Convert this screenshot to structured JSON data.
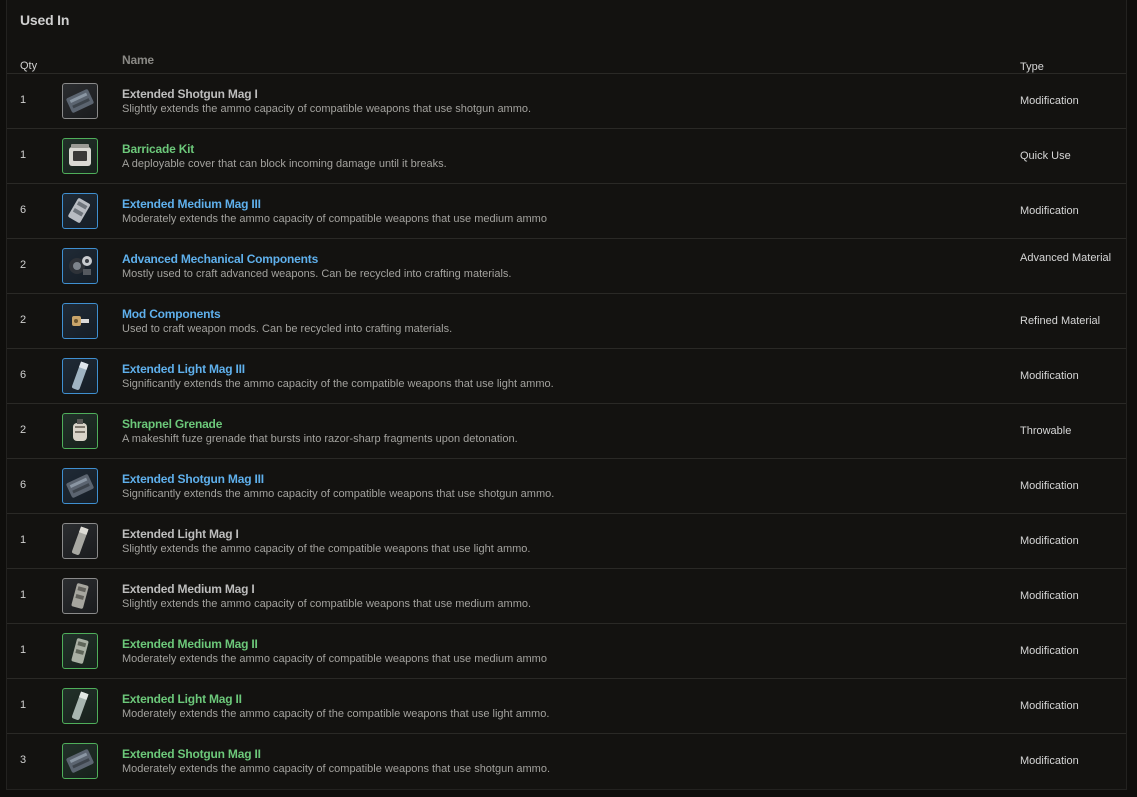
{
  "section_title": "Used In",
  "columns": {
    "qty": "Qty",
    "name": "Name",
    "type": "Type"
  },
  "rows": [
    {
      "qty": "1",
      "name": "Extended Shotgun Mag I",
      "rarity": "grey",
      "icon": "shotgun-mag-icon",
      "description": "Slightly extends the ammo capacity of compatible weapons that use shotgun ammo.",
      "type": "Modification"
    },
    {
      "qty": "1",
      "name": "Barricade Kit",
      "rarity": "green",
      "icon": "barricade-kit-icon",
      "description": "A deployable cover that can block incoming damage until it breaks.",
      "type": "Quick Use"
    },
    {
      "qty": "6",
      "name": "Extended Medium Mag III",
      "rarity": "blue",
      "icon": "medium-mag-icon",
      "description": "Moderately extends the ammo capacity of compatible weapons that use medium ammo",
      "type": "Modification"
    },
    {
      "qty": "2",
      "name": "Advanced Mechanical Components",
      "rarity": "blue",
      "icon": "mechanical-components-icon",
      "description": "Mostly used to craft advanced weapons. Can be recycled into crafting materials.",
      "type": "Advanced Material"
    },
    {
      "qty": "2",
      "name": "Mod Components",
      "rarity": "blue",
      "icon": "mod-components-icon",
      "description": "Used to craft weapon mods. Can be recycled into crafting materials.",
      "type": "Refined Material"
    },
    {
      "qty": "6",
      "name": "Extended Light Mag III",
      "rarity": "blue",
      "icon": "light-mag-icon",
      "description": "Significantly extends the ammo capacity of the compatible weapons that use light ammo.",
      "type": "Modification"
    },
    {
      "qty": "2",
      "name": "Shrapnel Grenade",
      "rarity": "green",
      "icon": "grenade-icon",
      "description": "A makeshift fuze grenade that bursts into razor-sharp fragments upon detonation.",
      "type": "Throwable"
    },
    {
      "qty": "6",
      "name": "Extended Shotgun Mag III",
      "rarity": "blue",
      "icon": "shotgun-mag-icon",
      "description": "Significantly extends the ammo capacity of compatible weapons that use shotgun ammo.",
      "type": "Modification"
    },
    {
      "qty": "1",
      "name": "Extended Light Mag I",
      "rarity": "grey",
      "icon": "light-mag-icon",
      "description": "Slightly extends the ammo capacity of the compatible weapons that use light ammo.",
      "type": "Modification"
    },
    {
      "qty": "1",
      "name": "Extended Medium Mag I",
      "rarity": "grey",
      "icon": "medium-mag-icon",
      "description": "Slightly extends the ammo capacity of compatible weapons that use medium ammo.",
      "type": "Modification"
    },
    {
      "qty": "1",
      "name": "Extended Medium Mag II",
      "rarity": "green",
      "icon": "medium-mag-icon",
      "description": "Moderately extends the ammo capacity of compatible weapons that use medium ammo",
      "type": "Modification"
    },
    {
      "qty": "1",
      "name": "Extended Light Mag II",
      "rarity": "green",
      "icon": "light-mag-icon",
      "description": "Moderately extends the ammo capacity of the compatible weapons that use light ammo.",
      "type": "Modification"
    },
    {
      "qty": "3",
      "name": "Extended Shotgun Mag II",
      "rarity": "green",
      "icon": "shotgun-mag-icon",
      "description": "Moderately extends the ammo capacity of compatible weapons that use shotgun ammo.",
      "type": "Modification"
    }
  ],
  "colors": {
    "background": "#131210",
    "rarity_grey": "#bdbdbd",
    "rarity_green": "#6cc87a",
    "rarity_blue": "#5fb0ec"
  }
}
